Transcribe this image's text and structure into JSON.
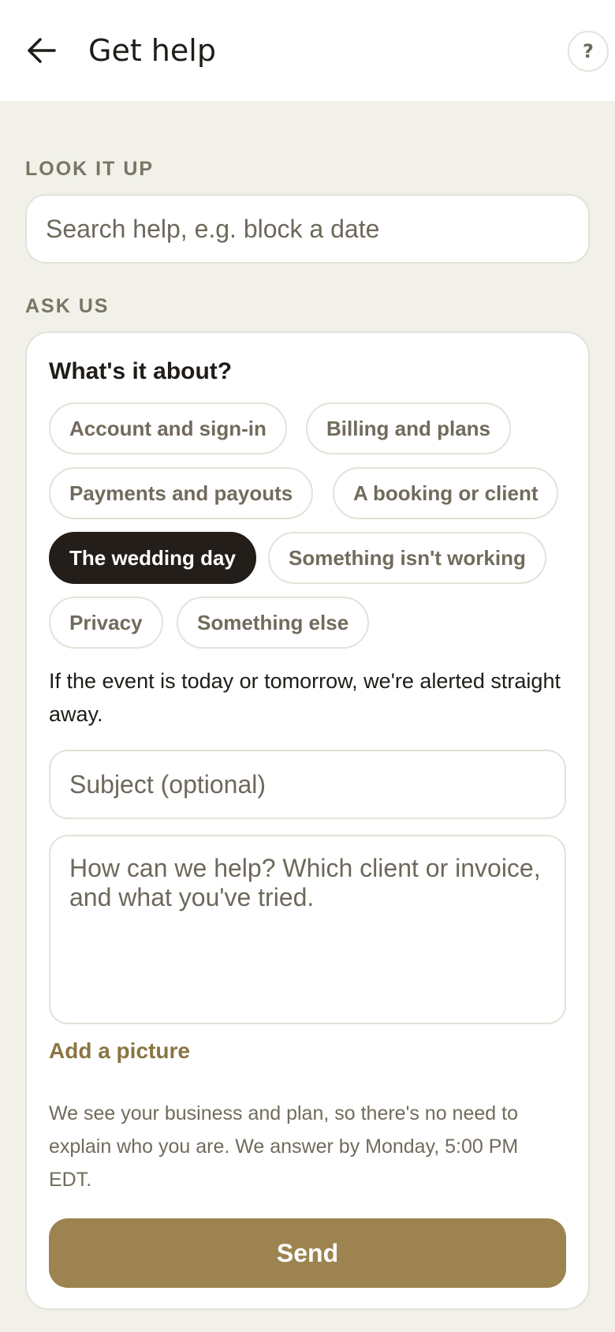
{
  "header": {
    "title": "Get help",
    "back_icon": "arrow-left-icon",
    "help_label": "?"
  },
  "lookup": {
    "section_label": "LOOK IT UP",
    "placeholder": "Search help, e.g. block a date",
    "value": ""
  },
  "ask": {
    "section_label": "ASK US",
    "heading": "What's it about?",
    "topics": [
      {
        "label": "Account and sign-in",
        "selected": false
      },
      {
        "label": "Billing and plans",
        "selected": false
      },
      {
        "label": "Payments and payouts",
        "selected": false
      },
      {
        "label": "A booking or client",
        "selected": false
      },
      {
        "label": "The wedding day",
        "selected": true
      },
      {
        "label": "Something isn't working",
        "selected": false
      },
      {
        "label": "Privacy",
        "selected": false
      },
      {
        "label": "Something else",
        "selected": false
      }
    ],
    "alert_note": "If the event is today or tomorrow, we're alerted straight away.",
    "subject_placeholder": "Subject (optional)",
    "message_placeholder": "How can we help? Which client or invoice, and what you've tried.",
    "add_picture_label": "Add a picture",
    "info_text": "We see your business and plan, so there's no need to explain who you are. We answer by Monday, 5:00 PM EDT.",
    "send_label": "Send"
  },
  "colors": {
    "background": "#f1f1ea",
    "accent": "#9c834f",
    "selected_chip": "#231e19",
    "muted_text": "#716b5c"
  }
}
